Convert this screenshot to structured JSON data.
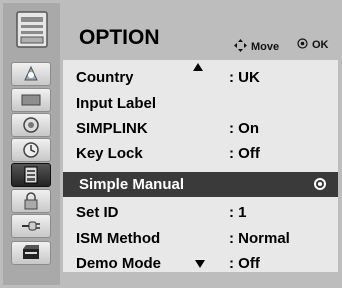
{
  "menu": {
    "title": "OPTION",
    "move_hint": "Move",
    "ok_hint": "OK",
    "items": [
      {
        "label": "Country",
        "value": ": UK"
      },
      {
        "label": "Input Label",
        "value": ""
      },
      {
        "label": "SIMPLINK",
        "value": ": On"
      },
      {
        "label": "Key Lock",
        "value": ": Off"
      },
      {
        "label": "Simple Manual",
        "value": ""
      },
      {
        "label": "Set ID",
        "value": ": 1"
      },
      {
        "label": "ISM Method",
        "value": ": Normal"
      },
      {
        "label": "Demo Mode",
        "value": ": Off"
      }
    ],
    "selected_index": 4
  },
  "sidebar": {
    "icons": [
      "option-icon",
      "picture-icon",
      "screen-icon",
      "audio-icon",
      "time-icon",
      "option-small-icon",
      "lock-icon",
      "input-icon",
      "usb-icon"
    ]
  },
  "colors": {
    "frame": "#bdbdbd",
    "panel": "#e8e8e8",
    "selected_row": "#3a3a3a"
  }
}
